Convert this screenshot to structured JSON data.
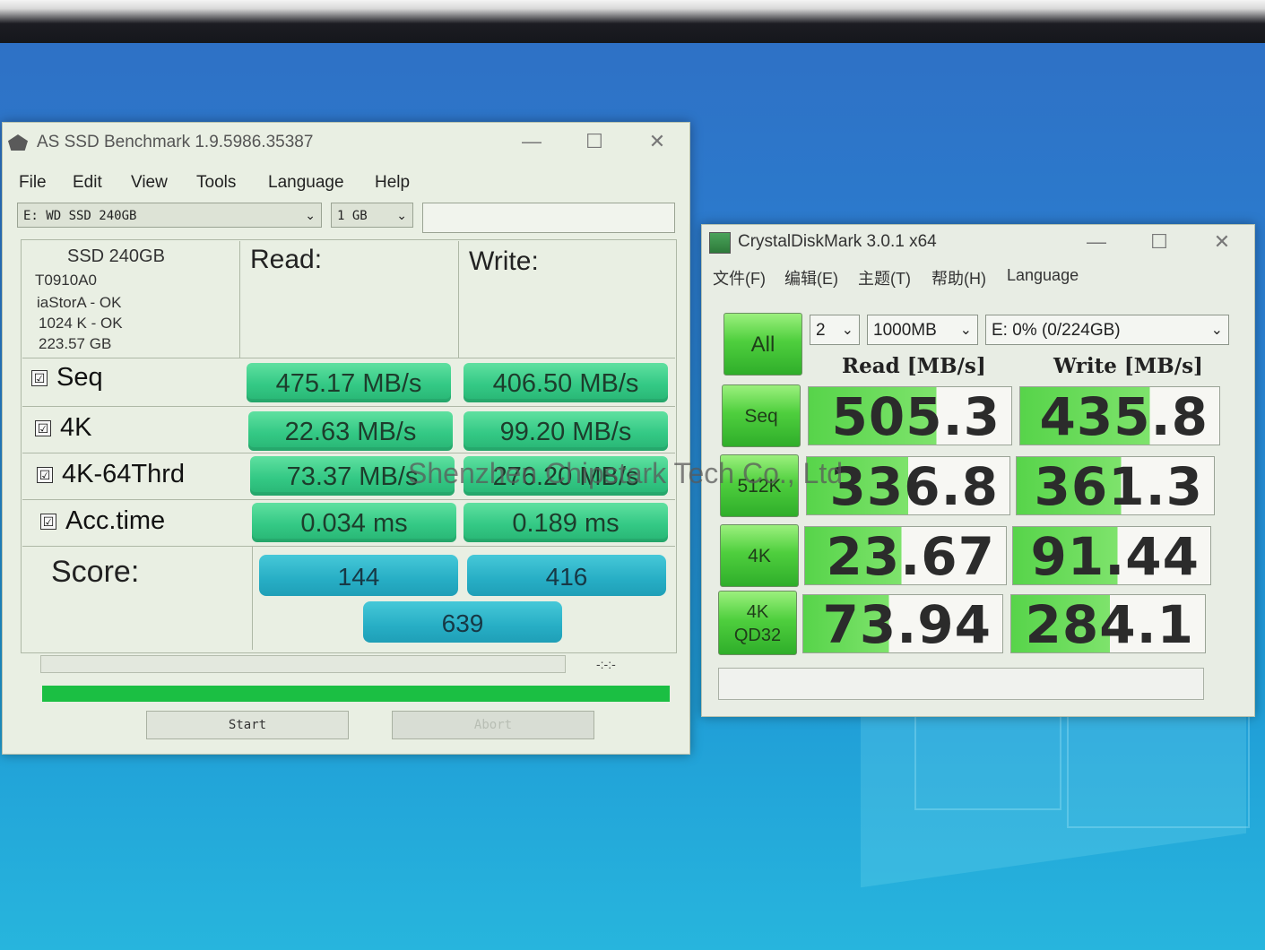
{
  "asssd": {
    "title": "AS SSD Benchmark 1.9.5986.35387",
    "menu": [
      "File",
      "Edit",
      "View",
      "Tools",
      "Language",
      "Help"
    ],
    "drive_select": "E: WD SSD 240GB",
    "size_select": "1 GB",
    "drive_info": {
      "model": "SSD 240GB",
      "firmware": "T0910A0",
      "driver": "iaStorA - OK",
      "alignment": "1024 K - OK",
      "capacity": "223.57 GB"
    },
    "headers": {
      "read": "Read:",
      "write": "Write:"
    },
    "rows": [
      {
        "label": "Seq",
        "read": "475.17 MB/s",
        "write": "406.50 MB/s"
      },
      {
        "label": "4K",
        "read": "22.63 MB/s",
        "write": "99.20 MB/s"
      },
      {
        "label": "4K-64Thrd",
        "read": "73.37 MB/s",
        "write": "276.20 MB/s"
      },
      {
        "label": "Acc.time",
        "read": "0.034 ms",
        "write": "0.189 ms"
      }
    ],
    "score_label": "Score:",
    "score_read": "144",
    "score_write": "416",
    "score_total": "639",
    "time": "-:-:-",
    "progress": 1.0,
    "start_label": "Start",
    "abort_label": "Abort",
    "check_glyph": "☑",
    "accent_color": "#1bbf43"
  },
  "cdm": {
    "title": "CrystalDiskMark 3.0.1 x64",
    "menu": [
      "文件(F)",
      "编辑(E)",
      "主题(T)",
      "帮助(H)",
      "Language"
    ],
    "all_label": "All",
    "count_select": "2",
    "size_select": "1000MB",
    "drive_select": "E: 0% (0/224GB)",
    "read_header": "Read [MB/s]",
    "write_header": "Write [MB/s]",
    "rows": [
      {
        "label": "Seq",
        "read": "505.3",
        "write": "435.8",
        "read_fill": 0.63,
        "write_fill": 0.65
      },
      {
        "label": "512K",
        "read": "336.8",
        "write": "361.3",
        "read_fill": 0.5,
        "write_fill": 0.53
      },
      {
        "label": "4K",
        "read": "23.67",
        "write": "91.44",
        "read_fill": 0.48,
        "write_fill": 0.53
      },
      {
        "label": "4K\nQD32",
        "read": "73.94",
        "write": "284.1",
        "read_fill": 0.43,
        "write_fill": 0.51
      }
    ]
  },
  "watermark": "Shenzhen Chipstark Tech Co., Ltd",
  "icons": {
    "dropdown": "chevron-down-icon",
    "close": "close-icon",
    "minimize": "minimize-icon",
    "maximize": "maximize-icon"
  },
  "glyphs": {
    "dropdown": "⌄",
    "close": "✕",
    "minimize": "—",
    "maximize": "☐"
  }
}
